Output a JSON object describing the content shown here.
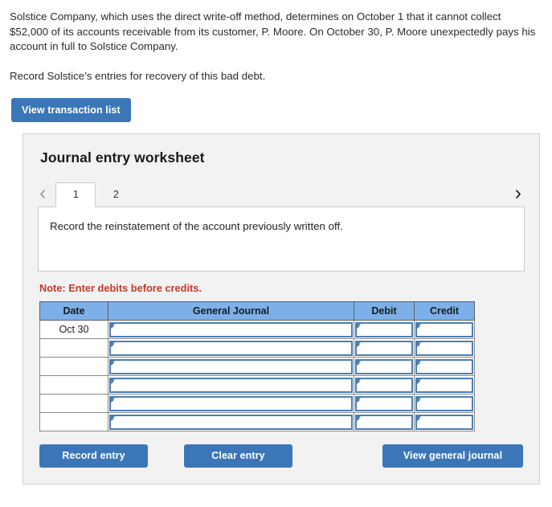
{
  "problem": {
    "paragraph1": "Solstice Company, which uses the direct write-off method, determines on October 1 that it cannot collect $52,000 of its accounts receivable from its customer, P. Moore. On October 30, P. Moore unexpectedly pays his account in full to Solstice Company.",
    "paragraph2": "Record Solstice’s entries for recovery of this bad debt."
  },
  "toolbar": {
    "view_transaction_list_label": "View transaction list"
  },
  "worksheet": {
    "title": "Journal entry worksheet",
    "tabs": [
      {
        "label": "1",
        "active": true
      },
      {
        "label": "2",
        "active": false
      }
    ],
    "prev_arrow": "‹",
    "next_arrow": "›",
    "instruction": "Record the reinstatement of the account previously written off.",
    "note": "Note: Enter debits before credits.",
    "table": {
      "columns": [
        "Date",
        "General Journal",
        "Debit",
        "Credit"
      ],
      "rows": [
        {
          "date": "Oct 30",
          "general_journal": "",
          "debit": "",
          "credit": ""
        },
        {
          "date": "",
          "general_journal": "",
          "debit": "",
          "credit": ""
        },
        {
          "date": "",
          "general_journal": "",
          "debit": "",
          "credit": ""
        },
        {
          "date": "",
          "general_journal": "",
          "debit": "",
          "credit": ""
        },
        {
          "date": "",
          "general_journal": "",
          "debit": "",
          "credit": ""
        },
        {
          "date": "",
          "general_journal": "",
          "debit": "",
          "credit": ""
        }
      ]
    },
    "buttons": {
      "record_entry": "Record entry",
      "clear_entry": "Clear entry",
      "view_general_journal": "View general journal"
    }
  },
  "colors": {
    "button_blue": "#3b77b8",
    "table_header_blue": "#7db0e8",
    "note_red": "#c0392b",
    "panel_gray": "#f2f2f2",
    "input_border_blue": "#4a7fb5"
  }
}
